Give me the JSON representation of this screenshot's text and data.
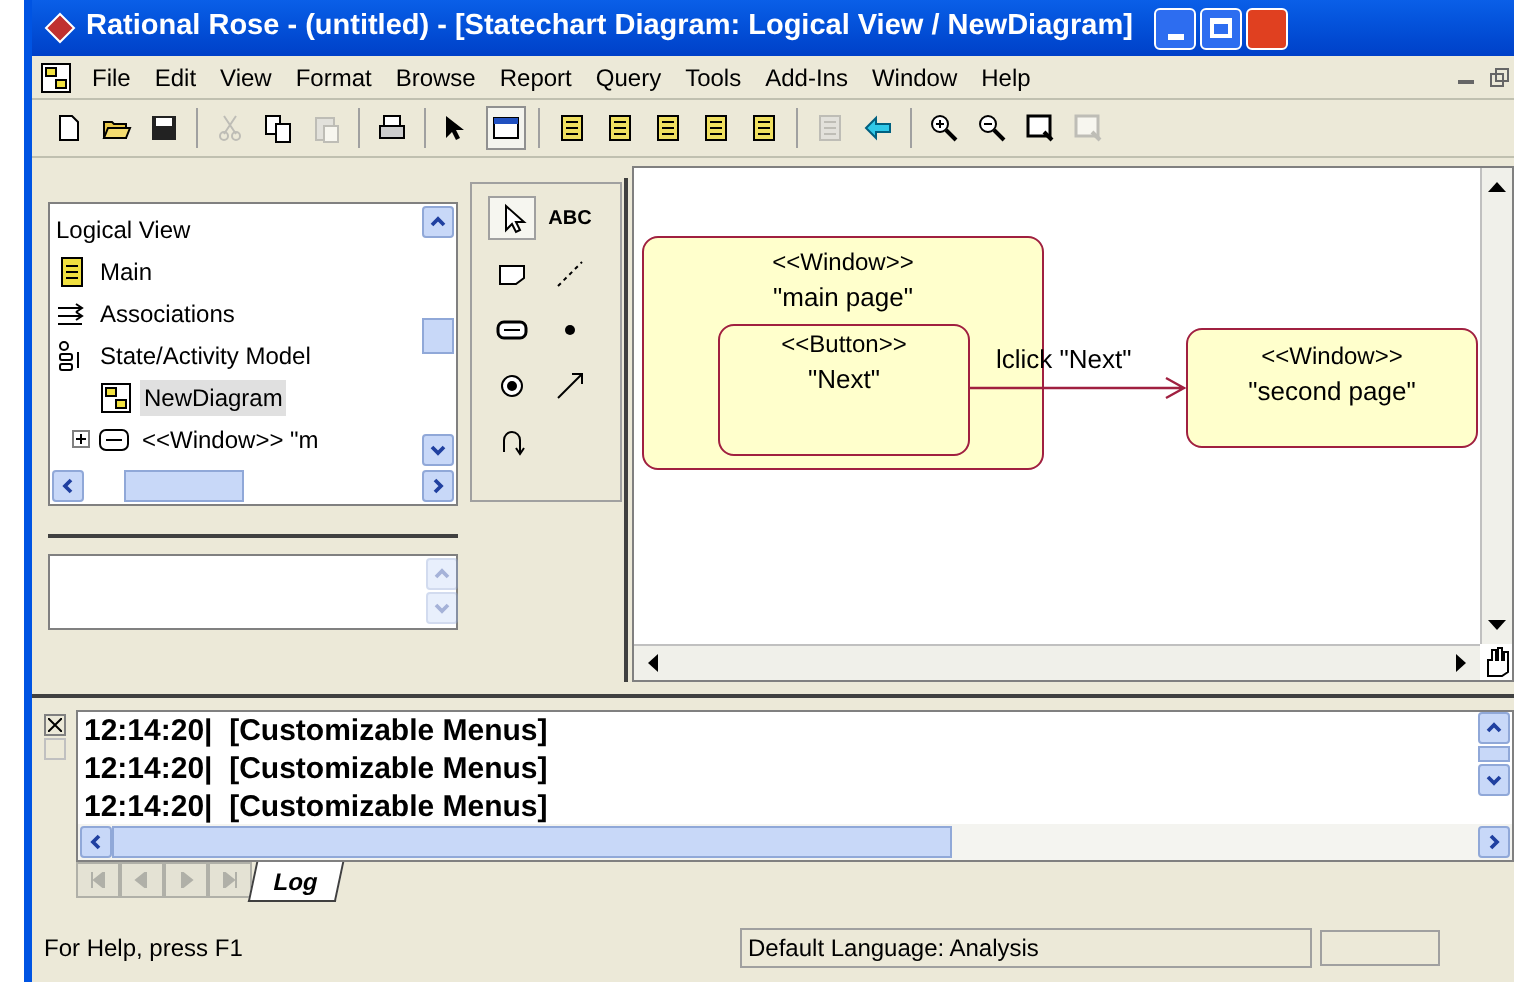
{
  "window": {
    "title": "Rational Rose - (untitled) - [Statechart Diagram: Logical View / NewDiagram]"
  },
  "menu": [
    "File",
    "Edit",
    "View",
    "Format",
    "Browse",
    "Report",
    "Query",
    "Tools",
    "Add-Ins",
    "Window",
    "Help"
  ],
  "toolbar": [
    {
      "kind": "new",
      "disabled": false
    },
    {
      "kind": "open",
      "disabled": false
    },
    {
      "kind": "save",
      "disabled": false
    },
    {
      "kind": "sep"
    },
    {
      "kind": "cut",
      "disabled": true
    },
    {
      "kind": "copy",
      "disabled": false
    },
    {
      "kind": "paste",
      "disabled": true
    },
    {
      "kind": "sep"
    },
    {
      "kind": "print",
      "disabled": false
    },
    {
      "kind": "sep"
    },
    {
      "kind": "help",
      "disabled": false
    },
    {
      "kind": "window",
      "disabled": false
    },
    {
      "kind": "sep"
    },
    {
      "kind": "doc",
      "disabled": false
    },
    {
      "kind": "doc",
      "disabled": false
    },
    {
      "kind": "doc",
      "disabled": false
    },
    {
      "kind": "doc",
      "disabled": false
    },
    {
      "kind": "doc",
      "disabled": false
    },
    {
      "kind": "sep"
    },
    {
      "kind": "doc",
      "disabled": true
    },
    {
      "kind": "back",
      "disabled": false
    },
    {
      "kind": "sep"
    },
    {
      "kind": "zoomin",
      "disabled": false
    },
    {
      "kind": "zoomout",
      "disabled": false
    },
    {
      "kind": "fit",
      "disabled": false
    },
    {
      "kind": "fit",
      "disabled": true
    }
  ],
  "browser": {
    "root": "Logical View",
    "children": [
      {
        "label": "Main",
        "kind": "diagram",
        "selected": false
      },
      {
        "label": "Associations",
        "kind": "assoc",
        "selected": false
      },
      {
        "label": "State/Activity Model",
        "kind": "model",
        "selected": false,
        "children": [
          {
            "label": "NewDiagram",
            "kind": "statechart",
            "selected": true
          },
          {
            "label": "<<Window>> \"m",
            "kind": "state",
            "selected": false,
            "expanded": false
          }
        ]
      }
    ]
  },
  "toolbox": [
    {
      "kind": "pointer",
      "selected": true
    },
    {
      "kind": "text",
      "label": "ABC",
      "selected": false
    },
    {
      "kind": "note",
      "selected": false
    },
    {
      "kind": "anchor",
      "selected": false
    },
    {
      "kind": "state",
      "selected": false
    },
    {
      "kind": "start",
      "selected": false
    },
    {
      "kind": "end",
      "selected": false
    },
    {
      "kind": "transition",
      "selected": false
    },
    {
      "kind": "self",
      "selected": false
    }
  ],
  "diagram": {
    "states": [
      {
        "stereotype": "<<Window>>",
        "name": "\"main page\"",
        "substate": {
          "stereotype": "<<Button>>",
          "name": "\"Next\""
        }
      },
      {
        "stereotype": "<<Window>>",
        "name": "\"second page\""
      }
    ],
    "transition": "lclick \"Next\""
  },
  "log": {
    "lines": [
      "12:14:20|  [Customizable Menus]",
      "12:14:20|  [Customizable Menus]",
      "12:14:20|  [Customizable Menus]"
    ],
    "tabs": [
      {
        "label": "Log",
        "selected": true
      }
    ]
  },
  "status_bar": {
    "help": "For Help, press F1",
    "language": "Default Language: Analysis"
  }
}
